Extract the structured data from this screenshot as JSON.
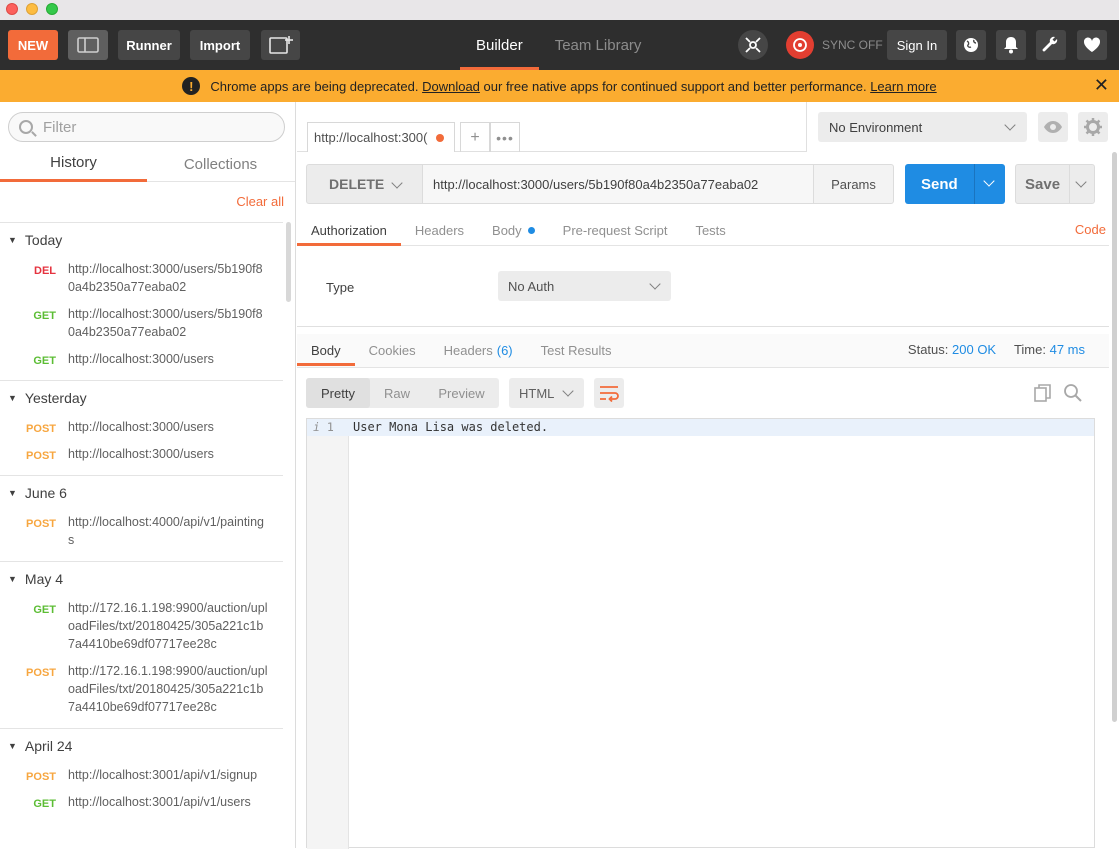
{
  "toolbar": {
    "new_label": "NEW",
    "runner_label": "Runner",
    "import_label": "Import",
    "tabs": [
      "Builder",
      "Team Library"
    ],
    "sync_label": "SYNC OFF",
    "signin_label": "Sign In",
    "accent_color": "#f26b3a"
  },
  "banner": {
    "message_start": "Chrome apps are being deprecated.",
    "download_link": "Download",
    "message_end": "our free native apps for continued support and better performance.",
    "learn_more": "Learn more",
    "close": "✕"
  },
  "sidebar": {
    "filter_placeholder": "Filter",
    "tabs": [
      "History",
      "Collections"
    ],
    "clear_all": "Clear all",
    "groups": [
      {
        "title": "Today",
        "items": [
          {
            "method": "DEL",
            "url": "http://localhost:3000/users/5b190f80a4b2350a77eaba02"
          },
          {
            "method": "GET",
            "url": "http://localhost:3000/users/5b190f80a4b2350a77eaba02"
          },
          {
            "method": "GET",
            "url": "http://localhost:3000/users"
          }
        ]
      },
      {
        "title": "Yesterday",
        "items": [
          {
            "method": "POST",
            "url": "http://localhost:3000/users"
          },
          {
            "method": "POST",
            "url": "http://localhost:3000/users"
          }
        ]
      },
      {
        "title": "June 6",
        "items": [
          {
            "method": "POST",
            "url": "http://localhost:4000/api/v1/paintings"
          }
        ]
      },
      {
        "title": "May 4",
        "items": [
          {
            "method": "GET",
            "url": "http://172.16.1.198:9900/auction/uploadFiles/txt/20180425/305a221c1b7a4410be69df07717ee28c"
          },
          {
            "method": "POST",
            "url": "http://172.16.1.198:9900/auction/uploadFiles/txt/20180425/305a221c1b7a4410be69df07717ee28c"
          }
        ]
      },
      {
        "title": "April 24",
        "items": [
          {
            "method": "POST",
            "url": "http://localhost:3001/api/v1/signup"
          },
          {
            "method": "GET",
            "url": "http://localhost:3001/api/v1/users"
          }
        ]
      }
    ]
  },
  "request": {
    "tab_label": "http://localhost:300(",
    "tab_plus": "+",
    "tab_more": "•••",
    "environment": "No Environment",
    "method": "DELETE",
    "url": "http://localhost:3000/users/5b190f80a4b2350a77eaba02",
    "params_label": "Params",
    "send_label": "Send",
    "save_label": "Save",
    "tabs": [
      "Authorization",
      "Headers",
      "Body",
      "Pre-request Script",
      "Tests"
    ],
    "code_label": "Code",
    "auth_type_label": "Type",
    "auth_type_value": "No Auth"
  },
  "response": {
    "tabs": [
      "Body",
      "Cookies",
      "Headers",
      "Test Results"
    ],
    "headers_count": "(6)",
    "status_label": "Status:",
    "status_value": "200 OK",
    "time_label": "Time:",
    "time_value": "47 ms",
    "view_modes": [
      "Pretty",
      "Raw",
      "Preview"
    ],
    "format": "HTML",
    "line_number": "1",
    "line_marker": "i",
    "body_text": "User Mona Lisa was deleted."
  }
}
